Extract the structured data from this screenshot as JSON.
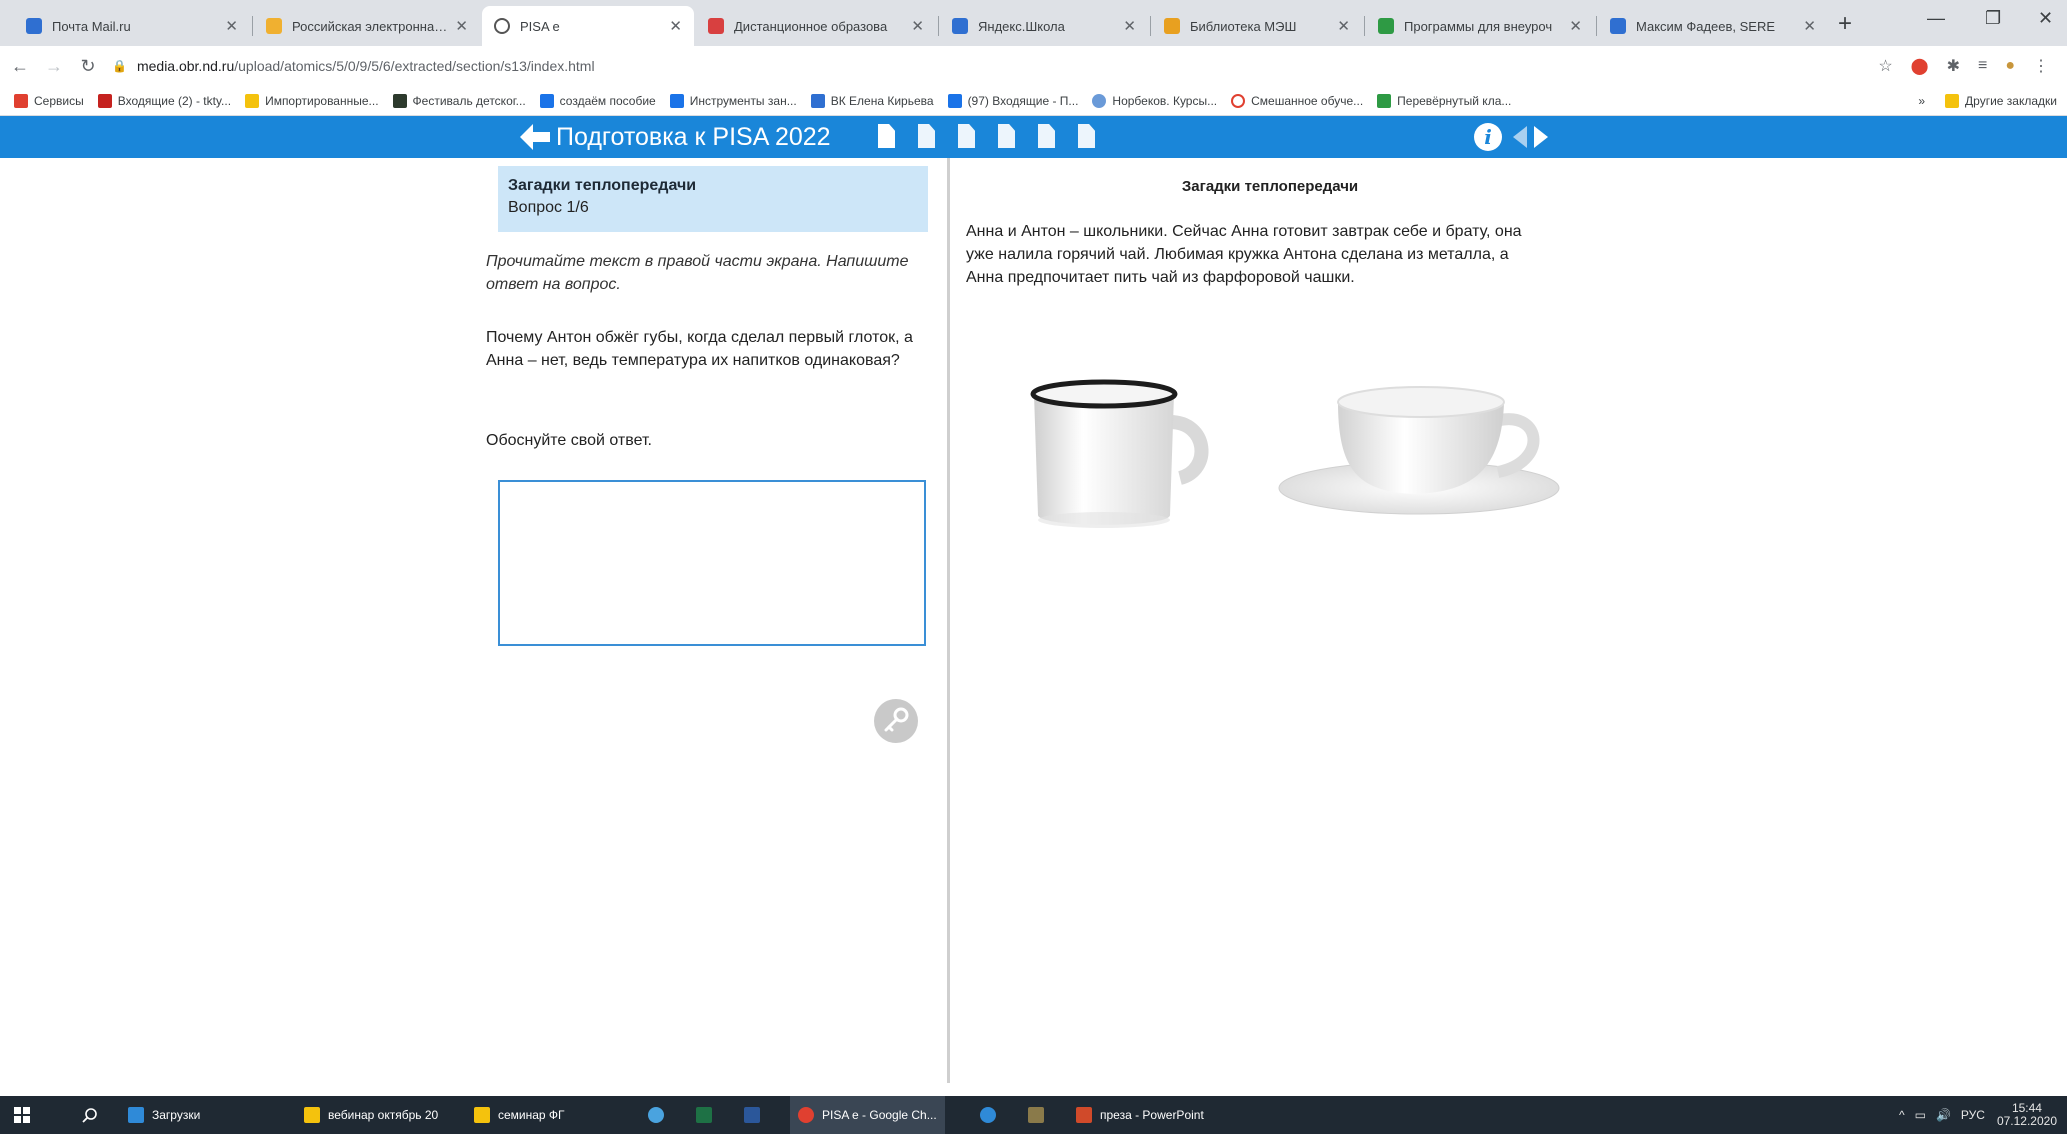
{
  "tabs": [
    {
      "title": "Почта Mail.ru",
      "color": "#2f6fd1"
    },
    {
      "title": "Российская электронная ш",
      "color": "#f0b030"
    },
    {
      "title": "PISA e",
      "color": "#555555",
      "active": true
    },
    {
      "title": "Дистанционное образова",
      "color": "#d84040"
    },
    {
      "title": "Яндекс.Школа",
      "color": "#2f6fd1"
    },
    {
      "title": "Библиотека МЭШ",
      "color": "#e8a020"
    },
    {
      "title": "Программы для внеуроч",
      "color": "#2e9a44"
    },
    {
      "title": "Максим Фадеев, SERE",
      "color": "#2f6fd1"
    }
  ],
  "browser": {
    "url_host": "media.obr.nd.ru",
    "url_path": "/upload/atomics/5/0/9/5/6/extracted/section/s13/index.html"
  },
  "bookmarks": [
    {
      "label": "Сервисы",
      "color": "#e04030"
    },
    {
      "label": "Входящие (2) - tkty...",
      "color": "#c5221f"
    },
    {
      "label": "Импортированные...",
      "color": "#f4c20d"
    },
    {
      "label": "Фестиваль детског...",
      "color": "#2d3a2d"
    },
    {
      "label": "создаём пособие",
      "color": "#1a73e8"
    },
    {
      "label": "Инструменты зан...",
      "color": "#1a73e8"
    },
    {
      "label": "ВК Елена Кирьева",
      "color": "#2f6fd1"
    },
    {
      "label": "(97) Входящие - П...",
      "color": "#1a73e8"
    },
    {
      "label": "Норбеков. Курсы...",
      "color": "#6a9ad8"
    },
    {
      "label": "Смешанное обуче...",
      "color": "#e04030"
    },
    {
      "label": "Перевёрнутый кла...",
      "color": "#2e9a44"
    }
  ],
  "bookmarks_other": "Другие закладки",
  "app": {
    "title": "Подготовка к PISA 2022",
    "page_count": 6,
    "accent": "#1a86d9"
  },
  "question": {
    "header_title": "Загадки теплопередачи",
    "number": "Вопрос 1/6",
    "instruction": "Прочитайте текст в правой части экрана. Напишите ответ на вопрос.",
    "text": "Почему Антон обжёг губы, когда сделал первый глоток, а Анна – нет, ведь температура их напитков одинаковая?",
    "justify": "Обоснуйте свой ответ.",
    "answer_value": ""
  },
  "reading": {
    "title": "Загадки теплопередачи",
    "text": "Анна и Антон – школьники. Сейчас Анна готовит завтрак себе и брату, она уже налила горячий чай. Любимая кружка Антона сделана из металла, а Анна предпочитает пить чай из фарфоровой чашки."
  },
  "taskbar": {
    "items": [
      {
        "label": "Загрузки",
        "color": "#2f8ad8"
      },
      {
        "label": "вебинар октябрь 20",
        "color": "#f4c20d"
      },
      {
        "label": "семинар ФГ",
        "color": "#f4c20d"
      },
      {
        "label": "PISA e - Google Ch...",
        "color": "#e04030"
      },
      {
        "label": "преза - PowerPoint",
        "color": "#d04a2a"
      }
    ],
    "lang": "РУС",
    "time": "15:44",
    "date": "07.12.2020"
  }
}
